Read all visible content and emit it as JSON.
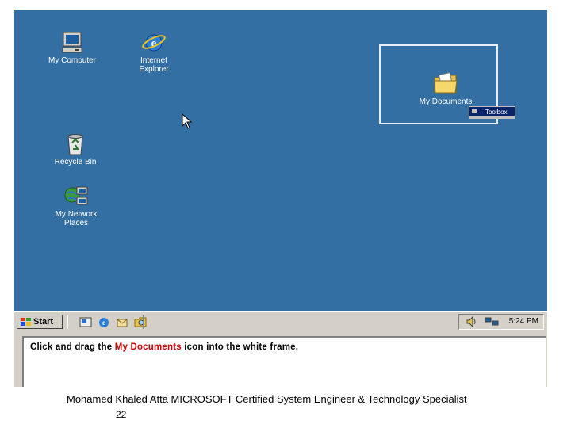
{
  "desktop": {
    "icons": [
      {
        "label_1": "My Computer",
        "label_2": ""
      },
      {
        "label_1": "Internet",
        "label_2": "Explorer"
      },
      {
        "label_1": "Recycle Bin",
        "label_2": ""
      },
      {
        "label_1": "My Network",
        "label_2": "Places"
      }
    ],
    "frame_icon_label": "My Documents",
    "toolbox_label": "Toolbox"
  },
  "taskbar": {
    "start_label": "Start",
    "clock": "5:24 PM"
  },
  "instruction": {
    "part1": "Click and drag the ",
    "highlight": "My Documents",
    "part2": " icon into the white frame."
  },
  "footer": {
    "text": "Mohamed Khaled Atta MICROSOFT Certified System Engineer & Technology Specialist",
    "page": "22"
  },
  "colors": {
    "desktop_bg": "#336fa2",
    "highlight": "#cc0000",
    "taskbar": "#d4d0c8"
  }
}
